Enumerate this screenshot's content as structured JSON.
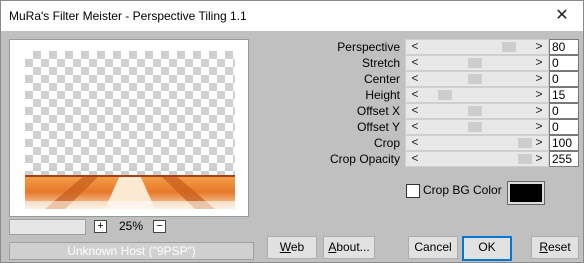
{
  "window": {
    "title": "MuRa's Filter Meister - Perspective Tiling 1.1",
    "close_glyph": "✕"
  },
  "preview": {
    "zoom": "25%",
    "zoom_in": "+",
    "zoom_out": "−"
  },
  "host_status": "Unknown Host (\"9PSP\")",
  "params": [
    {
      "label": "Perspective",
      "value": "80"
    },
    {
      "label": "Stretch",
      "value": "0"
    },
    {
      "label": "Center",
      "value": "0"
    },
    {
      "label": "Height",
      "value": "15"
    },
    {
      "label": "Offset X",
      "value": "0"
    },
    {
      "label": "Offset Y",
      "value": "0"
    },
    {
      "label": "Crop",
      "value": "100"
    },
    {
      "label": "Crop Opacity",
      "value": "255"
    }
  ],
  "slider_arrows": {
    "left": "<",
    "right": ">"
  },
  "crop_bg": {
    "label": "Crop BG Color",
    "checked": false,
    "color": "#000000"
  },
  "buttons": {
    "web": {
      "first": "W",
      "rest": "eb"
    },
    "about": {
      "first": "A",
      "rest": "bout..."
    },
    "cancel": "Cancel",
    "ok": "OK",
    "reset": {
      "first": "R",
      "rest": "eset"
    }
  }
}
